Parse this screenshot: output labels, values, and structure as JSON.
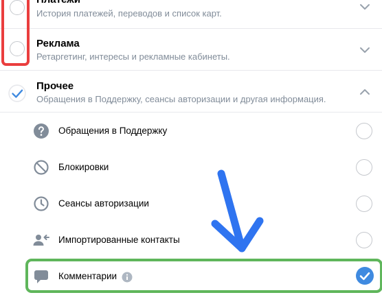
{
  "colors": {
    "red_highlight": "#ea3e3e",
    "green_highlight": "#5fb65b",
    "arrow_blue": "#2f74f0",
    "check_blue": "#3f8ae0",
    "gray_text": "#818c99"
  },
  "categories": [
    {
      "title": "Платежи",
      "subtitle": "История платежей, переводов и список карт.",
      "selected": false,
      "expanded": false
    },
    {
      "title": "Реклама",
      "subtitle": "Ретаргетинг, интересы и рекламные кабинеты.",
      "selected": false,
      "expanded": false
    },
    {
      "title": "Прочее",
      "subtitle": "Обращения в Поддержку, сеансы авторизации и другая информация.",
      "selected": true,
      "expanded": true
    }
  ],
  "subitems": [
    {
      "label": "Обращения в Поддержку",
      "icon": "question-circle-icon",
      "selected": false
    },
    {
      "label": "Блокировки",
      "icon": "block-icon",
      "selected": false
    },
    {
      "label": "Сеансы авторизации",
      "icon": "clock-icon",
      "selected": false
    },
    {
      "label": "Импортированные контакты",
      "icon": "user-import-icon",
      "selected": false
    },
    {
      "label": "Комментарии",
      "icon": "comment-icon",
      "selected": true
    }
  ]
}
